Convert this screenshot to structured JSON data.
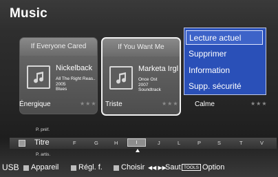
{
  "header": {
    "title": "Music"
  },
  "cards": [
    {
      "header": "If Everyone Cared",
      "artist": "Nickelback",
      "album": "All The Right Reas..",
      "year": "2005",
      "genre": "Blues",
      "mood": "Énergique",
      "stars": "★★★"
    },
    {
      "header": "If You Want Me",
      "artist": "Marketa Irgl...",
      "album": "Once Ost",
      "year": "2007",
      "genre": "Soundtrack",
      "mood": "Triste",
      "stars": "★★★"
    },
    {
      "mood": "Calme",
      "stars": "★★★"
    }
  ],
  "context_menu": {
    "items": [
      "Lecture actuel",
      "Supprimer",
      "Information",
      "Supp. sécurité"
    ],
    "active_index": 0
  },
  "sort_bar": {
    "prev_label": "P. préf.",
    "current_label": "Titre",
    "next_label": "P. artis.",
    "letters": [
      "F",
      "G",
      "H",
      "I",
      "J",
      "L",
      "P",
      "S",
      "T",
      "V"
    ],
    "highlighted": "I"
  },
  "bottom_bar": {
    "source": "USB",
    "device": "Appareil",
    "settings": "Régl. f.",
    "choose": "Choisir",
    "skip_glyph": "◀◀ ▶▶",
    "skip": "Saut",
    "tools_key": "TOOLS",
    "option": "Option"
  }
}
